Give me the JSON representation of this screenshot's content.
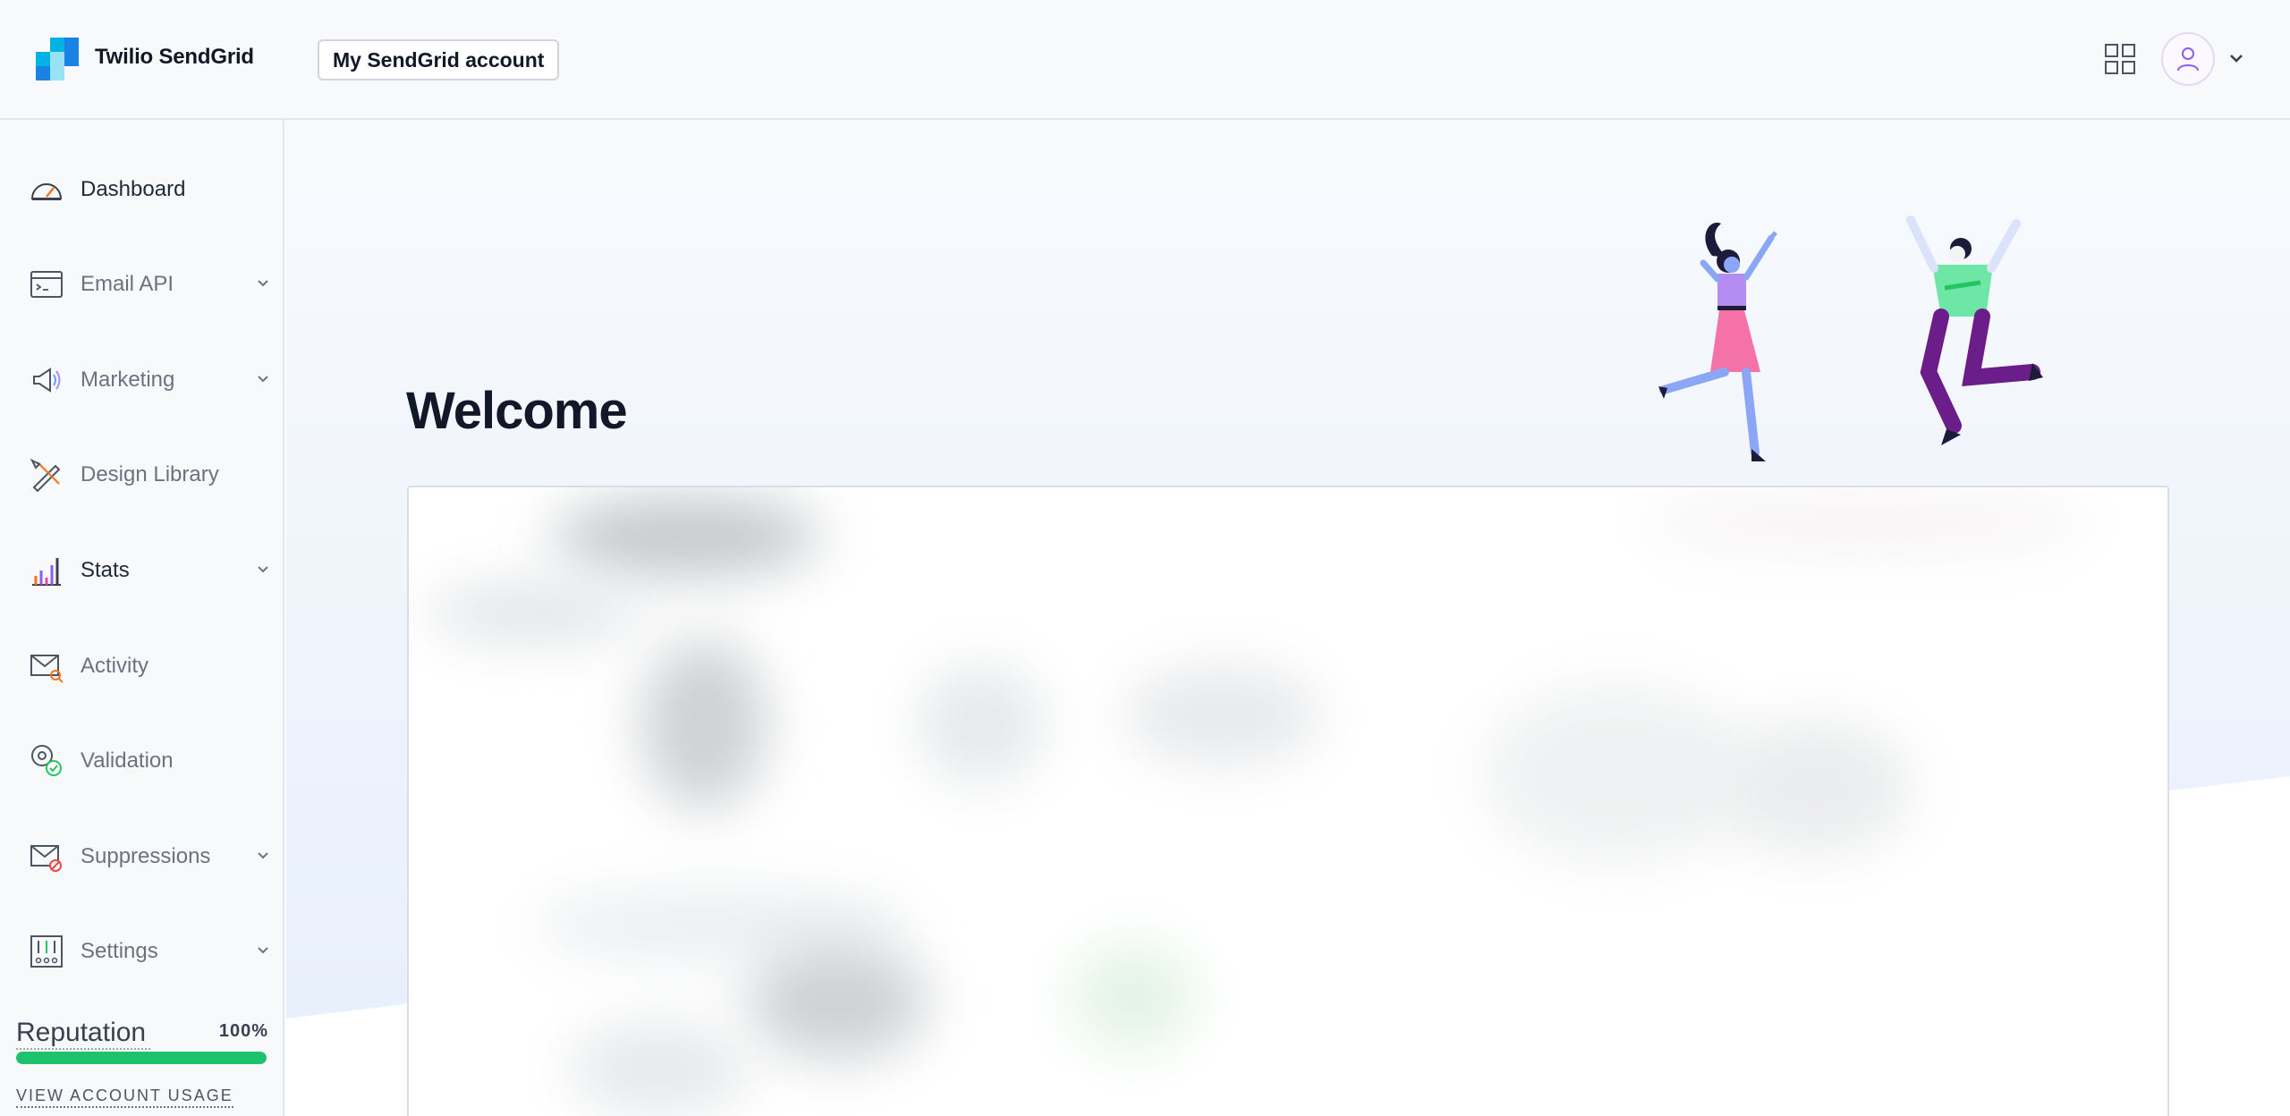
{
  "header": {
    "brand": "Twilio SendGrid",
    "account_button": "My SendGrid account",
    "apps_icon": "grid-icon",
    "avatar_icon": "user-icon"
  },
  "sidebar": {
    "items": [
      {
        "label": "Dashboard",
        "icon": "dashboard-gauge-icon",
        "active": true,
        "expandable": false
      },
      {
        "label": "Email API",
        "icon": "email-api-icon",
        "active": false,
        "expandable": true
      },
      {
        "label": "Marketing",
        "icon": "megaphone-icon",
        "active": false,
        "expandable": true
      },
      {
        "label": "Design Library",
        "icon": "design-tools-icon",
        "active": false,
        "expandable": false
      },
      {
        "label": "Stats",
        "icon": "stats-bars-icon",
        "active": true,
        "expandable": true
      },
      {
        "label": "Activity",
        "icon": "envelope-search-icon",
        "active": false,
        "expandable": false
      },
      {
        "label": "Validation",
        "icon": "at-check-icon",
        "active": false,
        "expandable": false
      },
      {
        "label": "Suppressions",
        "icon": "envelope-block-icon",
        "active": false,
        "expandable": true
      },
      {
        "label": "Settings",
        "icon": "sliders-icon",
        "active": false,
        "expandable": true
      }
    ],
    "reputation": {
      "title": "Reputation",
      "percent_label": "100%",
      "value": 1.0
    },
    "usage_link": "VIEW ACCOUNT USAGE"
  },
  "main": {
    "title": "Welcome"
  },
  "colors": {
    "brand_blue": "#1a82e2",
    "brand_light_blue": "#00b3e3",
    "reputation_green": "#1ec26c"
  }
}
